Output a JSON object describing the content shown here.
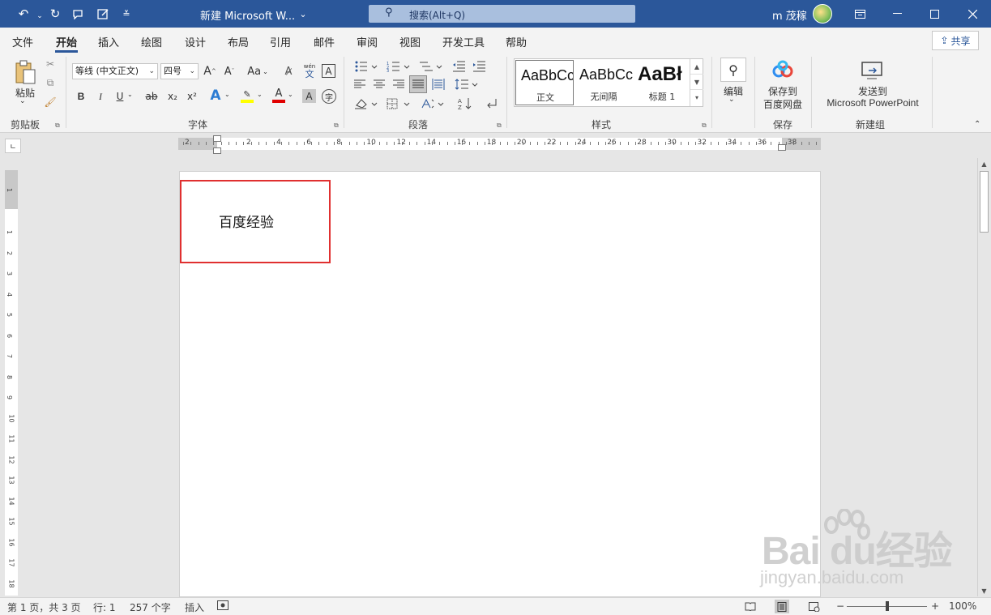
{
  "titlebar": {
    "doc_title": "新建 Microsoft W...",
    "search_placeholder": "搜索(Alt+Q)",
    "user_name": "m 茂稼",
    "accent": "#2b579a"
  },
  "menu": {
    "tabs": [
      "文件",
      "开始",
      "插入",
      "绘图",
      "设计",
      "布局",
      "引用",
      "邮件",
      "审阅",
      "视图",
      "开发工具",
      "帮助"
    ],
    "active_tab": "开始",
    "share": "共享"
  },
  "ribbon": {
    "clipboard": {
      "paste": "粘贴",
      "label": "剪贴板"
    },
    "font": {
      "font_name": "等线 (中文正文)",
      "font_size": "四号",
      "label": "字体",
      "grow": "A",
      "shrink": "A",
      "case": "Aa",
      "phonetic": "wén",
      "phonetic_char": "文",
      "bold": "B",
      "italic": "I",
      "underline": "U",
      "strike": "ab",
      "sub": "x₂",
      "sup": "x²",
      "effects": "A",
      "highlight": "ab",
      "color": "A",
      "shade": "A",
      "border": "A"
    },
    "paragraph": {
      "label": "段落"
    },
    "styles": {
      "label": "样式",
      "items": [
        {
          "sample": "AaBbCcI",
          "name": "正文"
        },
        {
          "sample": "AaBbCcI",
          "name": "无间隔"
        },
        {
          "sample": "AaBł",
          "name": "标题 1"
        }
      ]
    },
    "editing": {
      "label": "编辑"
    },
    "save": {
      "button_line1": "保存到",
      "button_line2": "百度网盘",
      "label": "保存"
    },
    "newgroup": {
      "button_line1": "发送到",
      "button_line2": "Microsoft PowerPoint",
      "label": "新建组"
    }
  },
  "ruler": {
    "h_labels": [
      "2",
      "2",
      "4",
      "6",
      "8",
      "10",
      "12",
      "14",
      "16",
      "18",
      "20",
      "22",
      "24",
      "26",
      "28",
      "30",
      "32",
      "34",
      "36",
      "38"
    ],
    "v_labels": [
      "1",
      "1",
      "2",
      "3",
      "4",
      "5",
      "6",
      "7",
      "8",
      "9",
      "10",
      "11",
      "12",
      "13",
      "14",
      "15",
      "16",
      "17",
      "18"
    ]
  },
  "document": {
    "text": "百度经验"
  },
  "watermark": {
    "line1": "Bai du经验",
    "line2": "jingyan.baidu.com"
  },
  "status": {
    "page": "第 1 页，共 3 页",
    "line": "行: 1",
    "words": "257 个字",
    "insert_mode": "插入",
    "zoom": "100%"
  }
}
